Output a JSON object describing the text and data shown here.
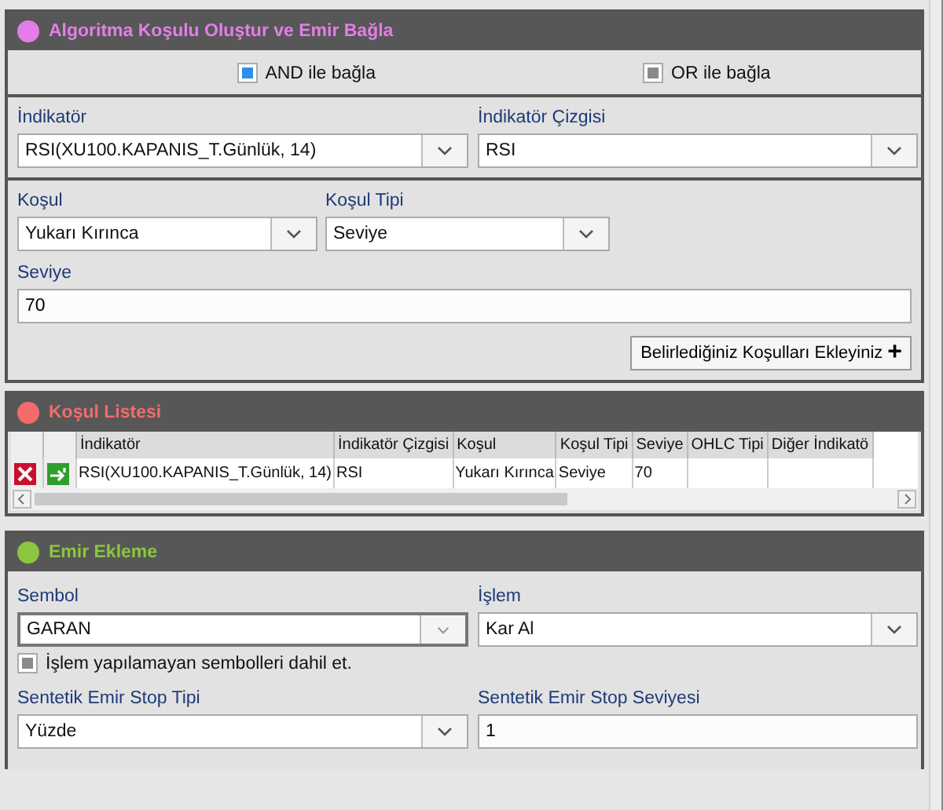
{
  "panels": [
    {
      "title": "Algoritma Koşulu Oluştur ve Emir Bağla",
      "color": "#e37ee8"
    },
    {
      "title": "Koşul Listesi",
      "color": "#f36b6b"
    },
    {
      "title": "Emir Ekleme",
      "color": "#8cc63f"
    }
  ],
  "link_options": [
    {
      "label": "AND ile bağla",
      "checked": true
    },
    {
      "label": "OR ile bağla",
      "checked": false
    }
  ],
  "indicator": {
    "label": "İndikatör",
    "value": "RSI(XU100.KAPANIS_T.Günlük, 14)"
  },
  "indicator_line": {
    "label": "İndikatör Çizgisi",
    "value": "RSI"
  },
  "condition": {
    "label": "Koşul",
    "value": "Yukarı Kırınca"
  },
  "condition_type": {
    "label": "Koşul Tipi",
    "value": "Seviye"
  },
  "level_field": {
    "label": "Seviye",
    "value": "70"
  },
  "add_button": {
    "label": "Belirlediğiniz Koşulları Ekleyiniz",
    "icon": "+"
  },
  "table": {
    "columns": [
      "İndikatör",
      "İndikatör Çizgisi",
      "Koşul",
      "Koşul Tipi",
      "Seviye",
      "OHLC Tipi",
      "Diğer İndikatö"
    ],
    "rows": [
      {
        "cells": [
          "RSI(XU100.KAPANIS_T.Günlük, 14)",
          "RSI",
          "Yukarı Kırınca",
          "Seviye",
          "70"
        ]
      }
    ]
  },
  "symbol": {
    "label": "Sembol",
    "value": "GARAN"
  },
  "operation": {
    "label": "İşlem",
    "value": "Kar Al"
  },
  "include_untradable": {
    "label": "İşlem yapılamayan sembolleri dahil et.",
    "checked": false
  },
  "stop_type": {
    "label": "Sentetik Emir Stop Tipi",
    "value": "Yüzde"
  },
  "stop_level": {
    "label": "Sentetik Emir Stop Seviyesi",
    "value": "1"
  }
}
